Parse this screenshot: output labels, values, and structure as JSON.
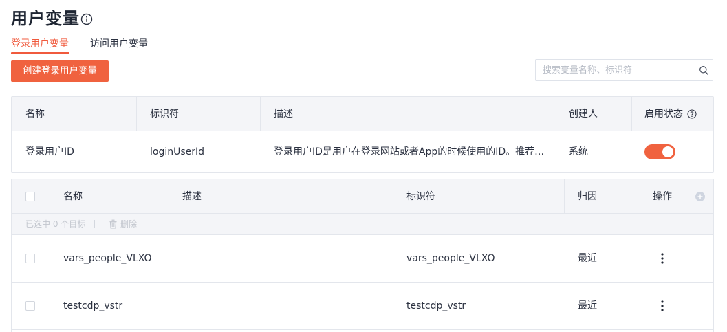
{
  "page": {
    "title": "用户变量"
  },
  "tabs": [
    {
      "label": "登录用户变量",
      "active": true
    },
    {
      "label": "访问用户变量",
      "active": false
    }
  ],
  "toolbar": {
    "create_label": "创建登录用户变量",
    "search_placeholder": "搜索变量名称、标识符",
    "search_value": ""
  },
  "login_table": {
    "columns": [
      "名称",
      "标识符",
      "描述",
      "创建人",
      "启用状态"
    ],
    "rows": [
      {
        "name": "登录用户ID",
        "identifier": "loginUserId",
        "description": "登录用户ID是用户在登录网站或者App的时候使用的ID。推荐…",
        "creator": "系统",
        "enabled": true
      }
    ]
  },
  "var_table": {
    "columns": [
      "名称",
      "描述",
      "标识符",
      "归因",
      "操作"
    ],
    "selection_text": "已选中 0 个目标",
    "delete_label": "删除",
    "rows": [
      {
        "name": "vars_people_VLXO",
        "description": "",
        "identifier": "vars_people_VLXO",
        "attribution": "最近",
        "checked": false
      },
      {
        "name": "testcdp_vstr",
        "description": "",
        "identifier": "testcdp_vstr",
        "attribution": "最近",
        "checked": false
      }
    ]
  },
  "colors": {
    "accent": "#f0623f",
    "header_bg": "#f4f5f8",
    "border": "#e3e6ec",
    "text": "#2b3140",
    "muted": "#c2c6ce"
  },
  "icons": {
    "title_info": "info-icon",
    "search": "search-icon",
    "status_help": "question-circle-icon",
    "trash": "trash-icon",
    "row_actions": "more-vertical-icon",
    "add_column": "plus-circle-icon"
  }
}
